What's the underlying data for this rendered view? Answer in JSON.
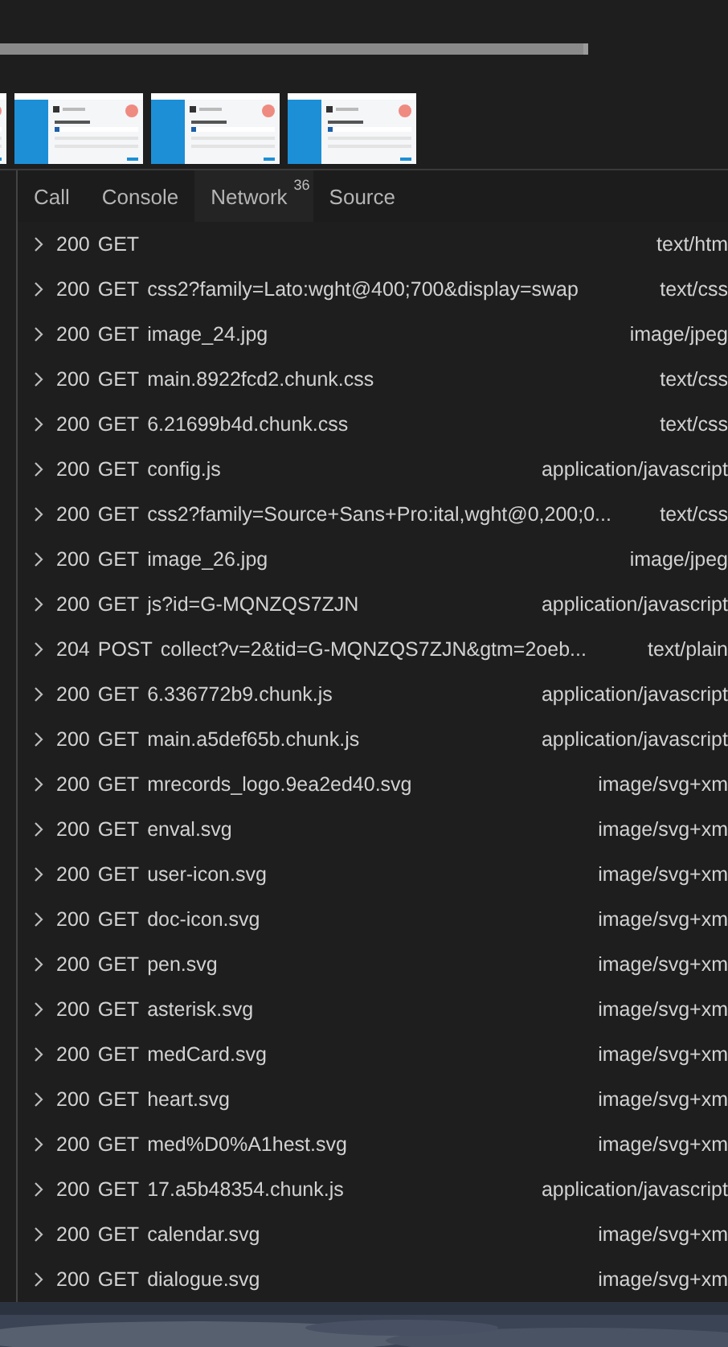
{
  "tabs": [
    {
      "label": "Call",
      "selected": false
    },
    {
      "label": "Console",
      "selected": false
    },
    {
      "label": "Network",
      "selected": true,
      "badge": "36"
    },
    {
      "label": "Source",
      "selected": false
    }
  ],
  "requests": [
    {
      "status": "200",
      "method": "GET",
      "type": "text/htm"
    },
    {
      "status": "200",
      "method": "GET",
      "name": "css2?family=Lato:wght@400;700&display=swap",
      "type": "text/css"
    },
    {
      "status": "200",
      "method": "GET",
      "name": "image_24.jpg",
      "type": "image/jpeg"
    },
    {
      "status": "200",
      "method": "GET",
      "name": "main.8922fcd2.chunk.css",
      "type": "text/css"
    },
    {
      "status": "200",
      "method": "GET",
      "name": "6.21699b4d.chunk.css",
      "type": "text/css"
    },
    {
      "status": "200",
      "method": "GET",
      "name": "config.js",
      "type": "application/javascript"
    },
    {
      "status": "200",
      "method": "GET",
      "name": "css2?family=Source+Sans+Pro:ital,wght@0,200;0...",
      "type": "text/css"
    },
    {
      "status": "200",
      "method": "GET",
      "name": "image_26.jpg",
      "type": "image/jpeg"
    },
    {
      "status": "200",
      "method": "GET",
      "name": "js?id=G-MQNZQS7ZJN",
      "type": "application/javascript"
    },
    {
      "status": "204",
      "method": "POST",
      "name": "collect?v=2&tid=G-MQNZQS7ZJN&gtm=2oeb...",
      "type": "text/plain"
    },
    {
      "status": "200",
      "method": "GET",
      "name": "6.336772b9.chunk.js",
      "type": "application/javascript"
    },
    {
      "status": "200",
      "method": "GET",
      "name": "main.a5def65b.chunk.js",
      "type": "application/javascript"
    },
    {
      "status": "200",
      "method": "GET",
      "name": "mrecords_logo.9ea2ed40.svg",
      "type": "image/svg+xm"
    },
    {
      "status": "200",
      "method": "GET",
      "name": "enval.svg",
      "type": "image/svg+xm"
    },
    {
      "status": "200",
      "method": "GET",
      "name": "user-icon.svg",
      "type": "image/svg+xm"
    },
    {
      "status": "200",
      "method": "GET",
      "name": "doc-icon.svg",
      "type": "image/svg+xm"
    },
    {
      "status": "200",
      "method": "GET",
      "name": "pen.svg",
      "type": "image/svg+xm"
    },
    {
      "status": "200",
      "method": "GET",
      "name": "asterisk.svg",
      "type": "image/svg+xm"
    },
    {
      "status": "200",
      "method": "GET",
      "name": "medCard.svg",
      "type": "image/svg+xm"
    },
    {
      "status": "200",
      "method": "GET",
      "name": "heart.svg",
      "type": "image/svg+xm"
    },
    {
      "status": "200",
      "method": "GET",
      "name": "med%D0%A1hest.svg",
      "type": "image/svg+xm"
    },
    {
      "status": "200",
      "method": "GET",
      "name": "17.a5b48354.chunk.js",
      "type": "application/javascript"
    },
    {
      "status": "200",
      "method": "GET",
      "name": "calendar.svg",
      "type": "image/svg+xm"
    },
    {
      "status": "200",
      "method": "GET",
      "name": "dialogue.svg",
      "type": "image/svg+xm"
    }
  ]
}
